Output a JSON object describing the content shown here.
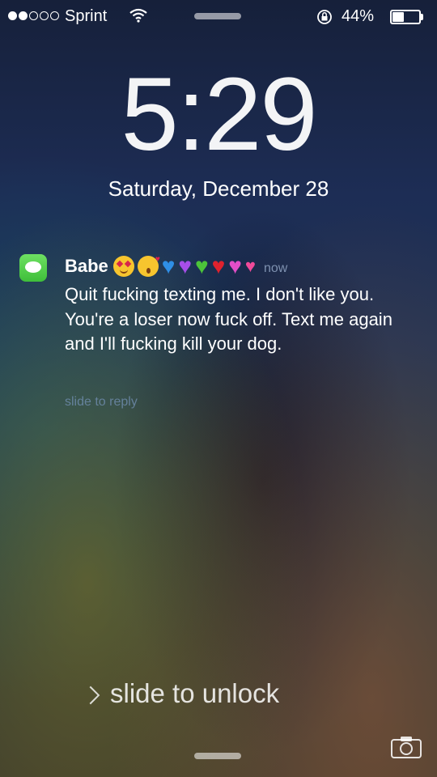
{
  "status_bar": {
    "carrier": "Sprint",
    "signal_bars": 2,
    "signal_total": 5,
    "wifi_icon": "wifi-icon",
    "orientation_lock_icon": "orientation-lock-icon",
    "battery_percent": "44%",
    "battery_level": 0.44
  },
  "lock_screen": {
    "time": "5:29",
    "date": "Saturday, December 28"
  },
  "notification": {
    "app_icon": "messages-icon",
    "sender": "Babe",
    "sender_emojis": [
      "heart-eyes-face-icon",
      "kissing-face-icon",
      "blue-heart-icon",
      "purple-heart-icon",
      "green-heart-icon",
      "red-heart-icon",
      "sparkling-heart-icon",
      "two-hearts-icon"
    ],
    "timestamp": "now",
    "message": "Quit fucking texting me. I don't like you. You're a loser now fuck off. Text me again and I'll fucking kill your dog.",
    "action_hint": "slide to reply"
  },
  "unlock": {
    "chevron_icon": "chevron-right-icon",
    "label": "slide to unlock"
  },
  "camera_icon": "camera-icon"
}
